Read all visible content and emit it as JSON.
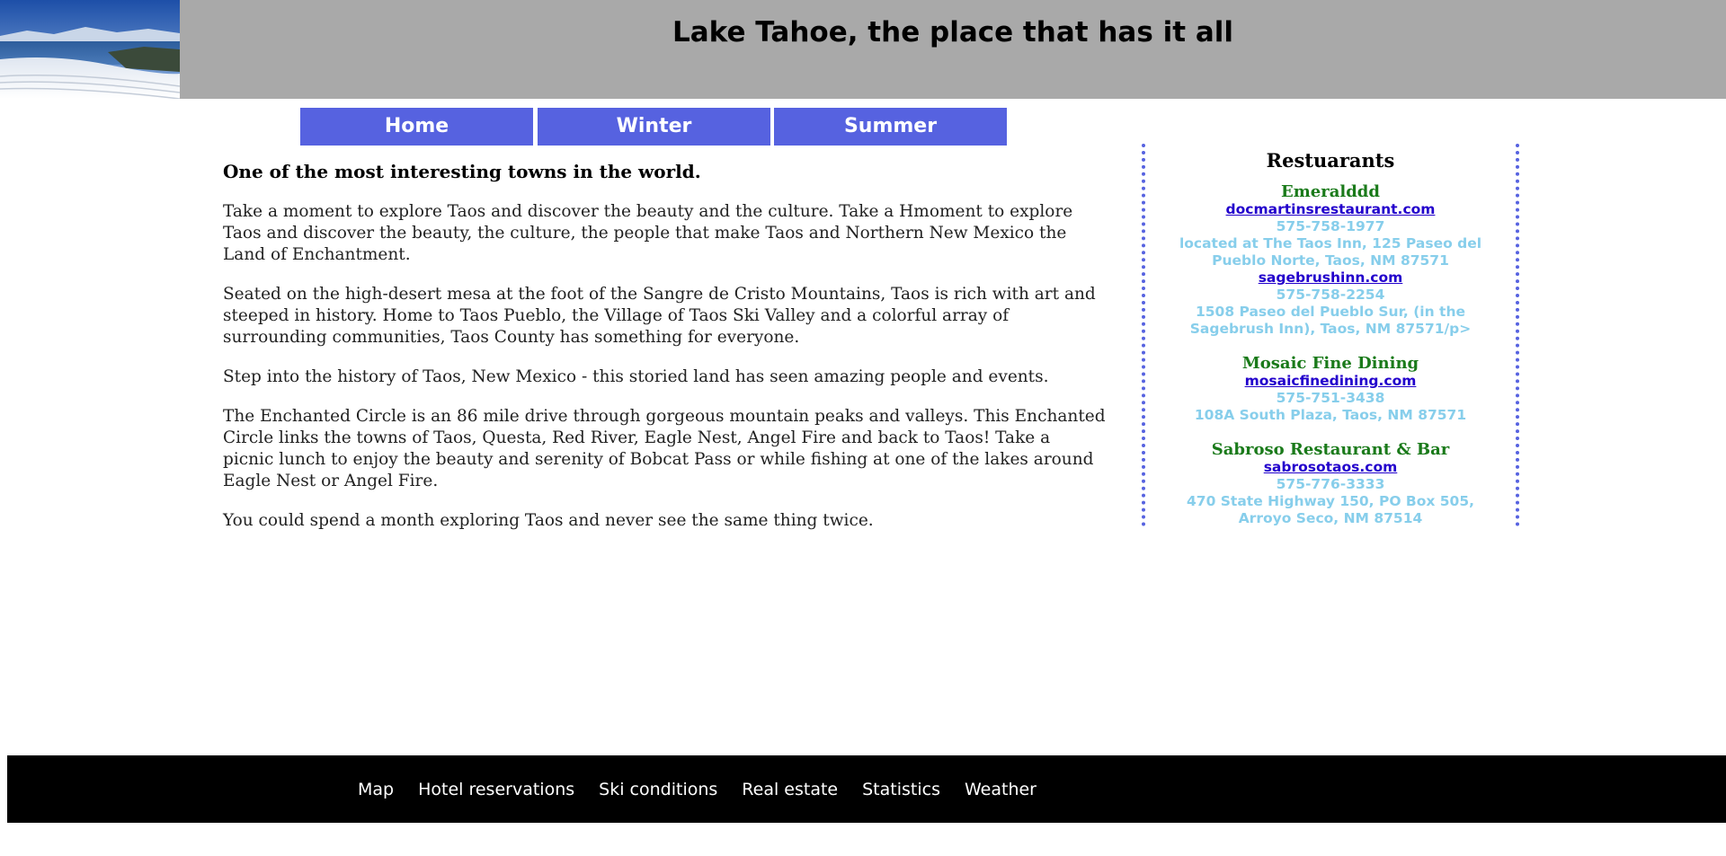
{
  "header": {
    "title": "Lake Tahoe, the place that has it all"
  },
  "nav": {
    "items": [
      {
        "label": "Home"
      },
      {
        "label": "Winter"
      },
      {
        "label": "Summer"
      }
    ]
  },
  "main": {
    "heading": "One of the most interesting towns in the world.",
    "paragraphs": [
      "Take a moment to explore Taos and discover the beauty and the culture. Take a Hmoment to explore Taos and discover the beauty, the culture, the people that make Taos and Northern New Mexico the Land of Enchantment.",
      "Seated on the high-desert mesa at the foot of the Sangre de Cristo Mountains, Taos is rich with art and steeped in history. Home to Taos Pueblo, the Village of Taos Ski Valley and a colorful array of surrounding communities, Taos County has something for everyone.",
      "Step into the history of Taos, New Mexico - this storied land has seen amazing people and events.",
      "The Enchanted Circle is an 86 mile drive through gorgeous mountain peaks and valleys. This Enchanted Circle links the towns of Taos, Questa, Red River, Eagle Nest, Angel Fire and back to Taos! Take a picnic lunch to enjoy the beauty and serenity of Bobcat Pass or while fishing at one of the lakes around Eagle Nest or Angel Fire.",
      "You could spend a month exploring Taos and never see the same thing twice."
    ]
  },
  "sidebar": {
    "title": "Restuarants",
    "restaurants": [
      {
        "name": "Emeralddd",
        "link1": "docmartinsrestaurant.com",
        "phone1": "575-758-1977",
        "address1": "located at The Taos Inn, 125 Paseo del Pueblo Norte, Taos, NM 87571",
        "link2": "sagebrushinn.com",
        "phone2": "575-758-2254",
        "address2": "1508 Paseo del Pueblo Sur, (in the Sagebrush Inn), Taos, NM 87571/p>"
      },
      {
        "name": "Mosaic Fine Dining",
        "link": "mosaicfinedining.com",
        "phone": "575-751-3438",
        "address": "108A South Plaza, Taos, NM 87571"
      },
      {
        "name": "Sabroso Restaurant & Bar",
        "link": "sabrosotaos.com",
        "phone": "575-776-3333",
        "address": "470 State Highway 150, PO Box 505, Arroyo Seco, NM 87514"
      }
    ]
  },
  "footer": {
    "links": [
      "Map",
      "Hotel reservations",
      "Ski conditions",
      "Real estate",
      "Statistics",
      "Weather"
    ]
  },
  "colors": {
    "header_bg": "#a9a9a9",
    "nav_bg": "#5662e0",
    "restaurant_name": "#1a7a1a",
    "restaurant_info": "#87ceeb",
    "footer_bg": "#000000"
  }
}
